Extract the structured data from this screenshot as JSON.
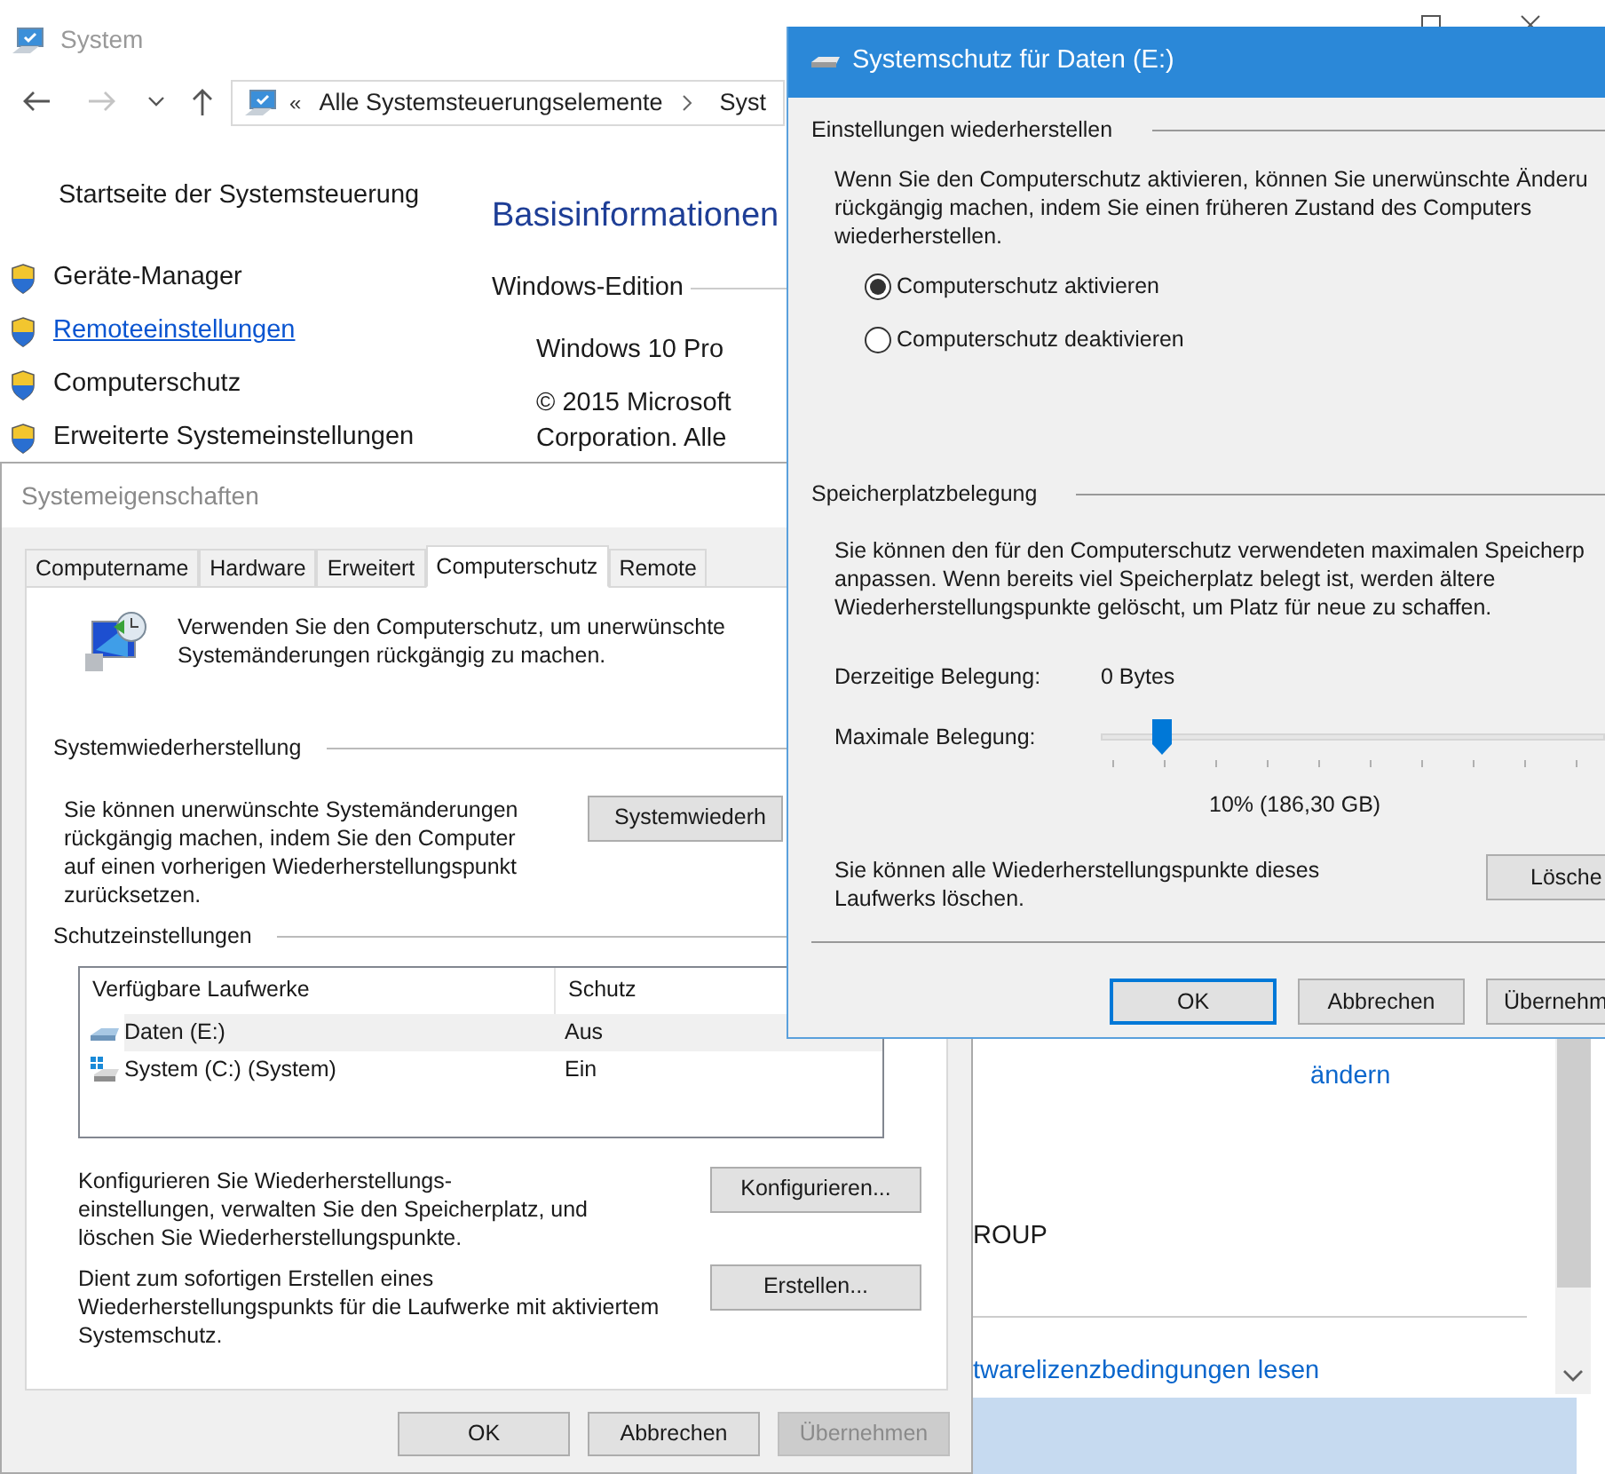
{
  "system_window": {
    "title": "System",
    "nav": [
      {
        "kind": "back",
        "disabled": false
      },
      {
        "kind": "forward",
        "disabled": true
      },
      {
        "kind": "recent",
        "disabled": false
      },
      {
        "kind": "up",
        "disabled": false
      }
    ],
    "address": {
      "overflow": "«",
      "crumbs": [
        "Alle Systemsteuerungselemente",
        "Syst"
      ]
    },
    "home_link": "Startseite der Systemsteuerung",
    "sidebar_items": [
      {
        "label": "Geräte-Manager",
        "hovered": false
      },
      {
        "label": "Remoteeinstellungen",
        "hovered": true
      },
      {
        "label": "Computerschutz",
        "hovered": false
      },
      {
        "label": "Erweiterte Systemeinstellungen",
        "hovered": false
      }
    ],
    "heading": "Basisinformationen",
    "section": "Windows-Edition",
    "edition_lines": [
      "Windows 10 Pro",
      "© 2015 Microsoft\nCorporation. Alle"
    ],
    "change_link": "ändern",
    "workgroup_fragment": "ROUP",
    "license_link": "twarelizenzbedingungen lesen"
  },
  "system_properties": {
    "title": "Systemeigenschaften",
    "tabs": [
      {
        "label": "Computername",
        "selected": false
      },
      {
        "label": "Hardware",
        "selected": false
      },
      {
        "label": "Erweitert",
        "selected": false
      },
      {
        "label": "Computerschutz",
        "selected": true
      },
      {
        "label": "Remote",
        "selected": false
      }
    ],
    "intro": "Verwenden Sie den Computerschutz, um unerwünschte\nSystemänderungen rückgängig zu machen.",
    "restore": {
      "heading": "Systemwiederherstellung",
      "text": "Sie können unerwünschte Systemänderungen\nrückgängig machen, indem Sie den Computer\nauf einen vorherigen Wiederherstellungspunkt\nzurücksetzen.",
      "button": "Systemwiederh"
    },
    "protection": {
      "heading": "Schutzeinstellungen",
      "columns": [
        "Verfügbare Laufwerke",
        "Schutz"
      ],
      "drives": [
        {
          "name": "Daten (E:)",
          "protection": "Aus",
          "kind": "data",
          "selected": true
        },
        {
          "name": "System (C:) (System)",
          "protection": "Ein",
          "kind": "system",
          "selected": false
        }
      ],
      "configure_text": "Konfigurieren Sie Wiederherstellungs-\neinstellungen, verwalten Sie den Speicherplatz, und\nlöschen Sie Wiederherstellungspunkte.",
      "configure_button": "Konfigurieren...",
      "create_text": "Dient zum sofortigen Erstellen eines\nWiederherstellungspunkts für die Laufwerke mit aktiviertem\nSystemschutz.",
      "create_button": "Erstellen..."
    },
    "buttons": [
      {
        "label": "OK",
        "disabled": false
      },
      {
        "label": "Abbrechen",
        "disabled": false
      },
      {
        "label": "Übernehmen",
        "disabled": true
      }
    ]
  },
  "protection_dialog": {
    "title": "Systemschutz für Daten (E:)",
    "restore_settings": {
      "heading": "Einstellungen wiederherstellen",
      "text": "Wenn Sie den Computerschutz aktivieren, können Sie unerwünschte Änderu\nrückgängig machen, indem Sie einen früheren Zustand des Computers\nwiederherstellen.",
      "options": [
        {
          "label": "Computerschutz aktivieren",
          "selected": true
        },
        {
          "label": "Computerschutz deaktivieren",
          "selected": false
        }
      ]
    },
    "disk_usage": {
      "heading": "Speicherplatzbelegung",
      "text": "Sie können den für den Computerschutz verwendeten maximalen Speicherp\nanpassen. Wenn bereits viel Speicherplatz belegt ist, werden ältere\nWiederherstellungspunkte gelöscht, um Platz für neue zu schaffen.",
      "current_label": "Derzeitige Belegung:",
      "current_value": "0 Bytes",
      "max_label": "Maximale Belegung:",
      "slider": {
        "level": 0.1
      },
      "slider_reading": "10% (186,30 GB)",
      "delete_text": "Sie können alle Wiederherstellungspunkte dieses\nLaufwerks löschen.",
      "delete_button": "Lösche"
    },
    "buttons": [
      {
        "label": "OK",
        "default": true
      },
      {
        "label": "Abbrechen",
        "default": false
      },
      {
        "label": "Übernehm",
        "default": false
      }
    ]
  }
}
